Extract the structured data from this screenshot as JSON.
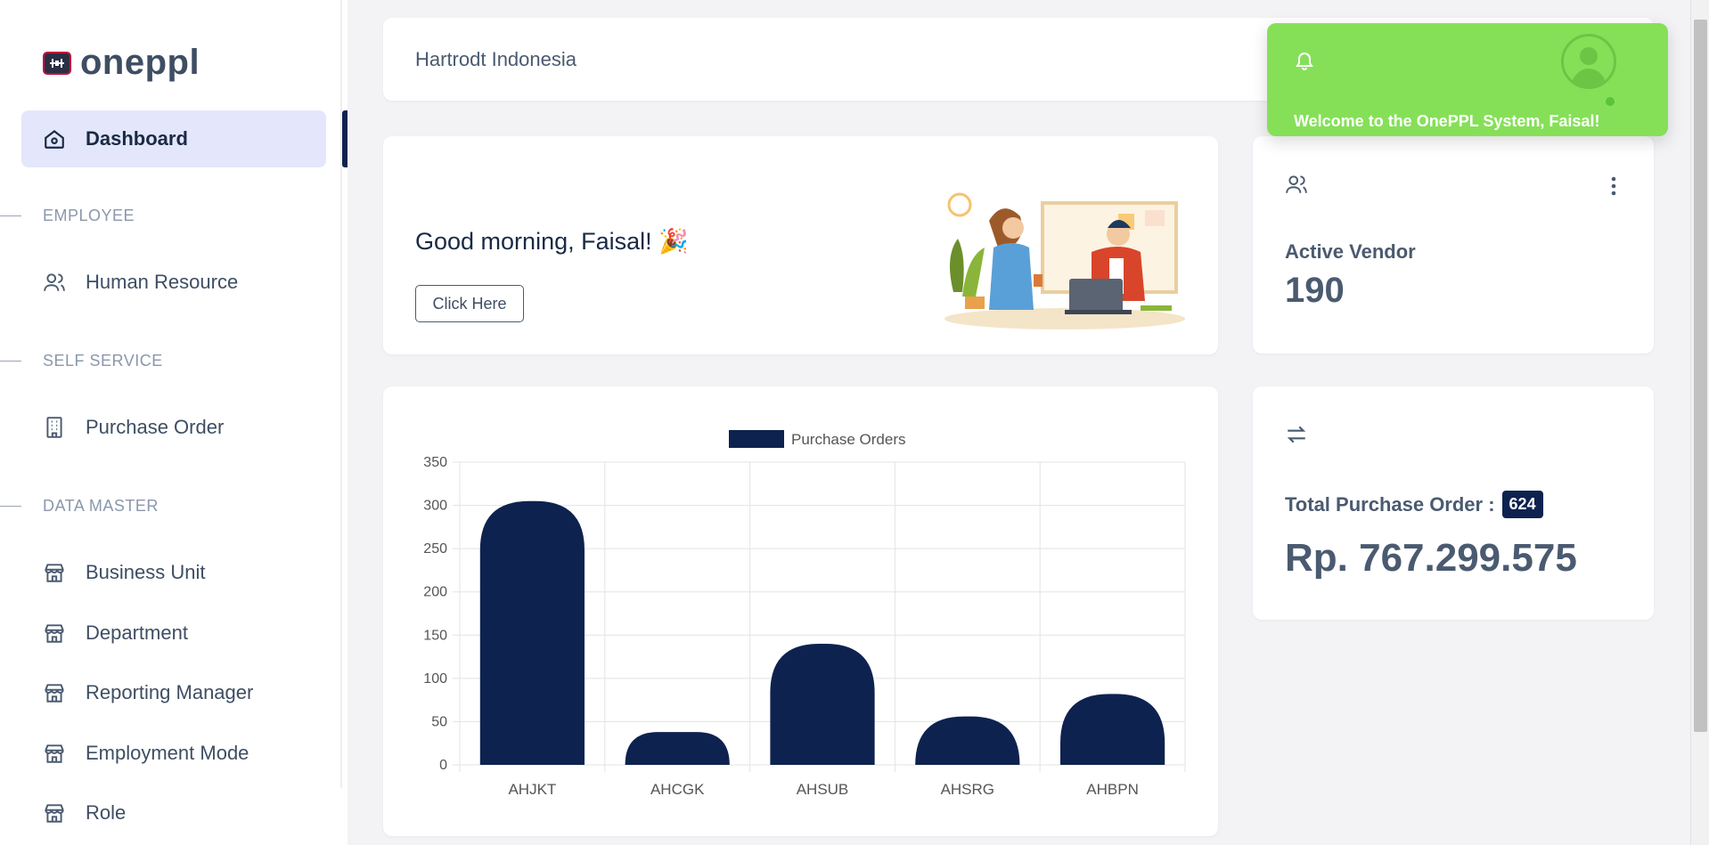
{
  "app": {
    "logo_text": "oneppl"
  },
  "sidebar": {
    "dashboard": "Dashboard",
    "sections": [
      "EMPLOYEE",
      "SELF SERVICE",
      "DATA MASTER"
    ],
    "employee_items": [
      "Human Resource"
    ],
    "self_service_items": [
      "Purchase Order"
    ],
    "data_master_items": [
      "Business Unit",
      "Department",
      "Reporting Manager",
      "Employment Mode",
      "Role"
    ]
  },
  "topbar": {
    "company": "Hartrodt Indonesia"
  },
  "toast": {
    "message": "Welcome to the OnePPL System, Faisal!"
  },
  "welcome": {
    "greeting": "Good morning, Faisal! 🎉",
    "button": "Click Here"
  },
  "vendor": {
    "label": "Active Vendor",
    "value": "190"
  },
  "purchase": {
    "label": "Total Purchase Order :",
    "count": "624",
    "amount": "Rp. 767.299.575"
  },
  "colors": {
    "accent": "#0e2250",
    "toast": "#85e058",
    "active_nav": "#e4e6fb"
  },
  "chart_data": {
    "type": "bar",
    "categories": [
      "AHJKT",
      "AHCGK",
      "AHSUB",
      "AHSRG",
      "AHBPN"
    ],
    "series": [
      {
        "name": "Purchase Orders",
        "values": [
          305,
          38,
          140,
          56,
          82
        ]
      }
    ],
    "ylim": [
      0,
      350
    ],
    "yticks": [
      0,
      50,
      100,
      150,
      200,
      250,
      300,
      350
    ],
    "legend": "top",
    "grid": true
  }
}
